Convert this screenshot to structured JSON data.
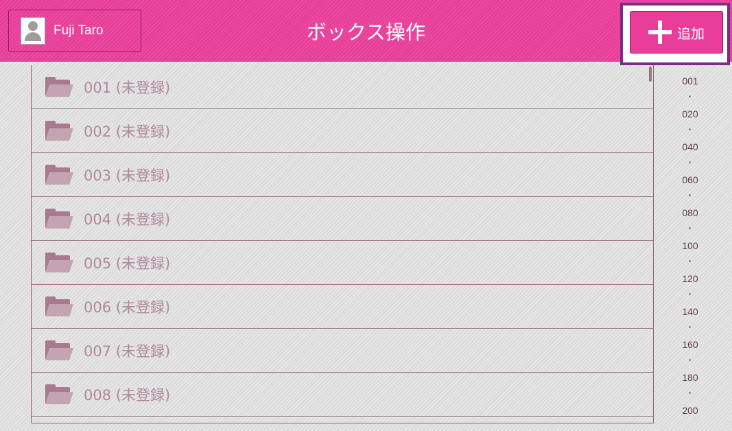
{
  "header": {
    "user_name": "Fuji Taro",
    "title": "ボックス操作",
    "add_label": "追加",
    "icons": {
      "user": "user-avatar-icon",
      "add": "plus-icon",
      "folder": "folder-icon"
    },
    "colors": {
      "header_bg": "#e83e9a",
      "add_highlight": "#7c2b86",
      "text_muted": "#b1889d"
    }
  },
  "boxes": [
    {
      "label": "001 (未登録)"
    },
    {
      "label": "002 (未登録)"
    },
    {
      "label": "003 (未登録)"
    },
    {
      "label": "004 (未登録)"
    },
    {
      "label": "005 (未登録)"
    },
    {
      "label": "006 (未登録)"
    },
    {
      "label": "007 (未登録)"
    },
    {
      "label": "008 (未登録)"
    }
  ],
  "index": [
    "001",
    "020",
    "040",
    "060",
    "080",
    "100",
    "120",
    "140",
    "160",
    "180",
    "200"
  ]
}
